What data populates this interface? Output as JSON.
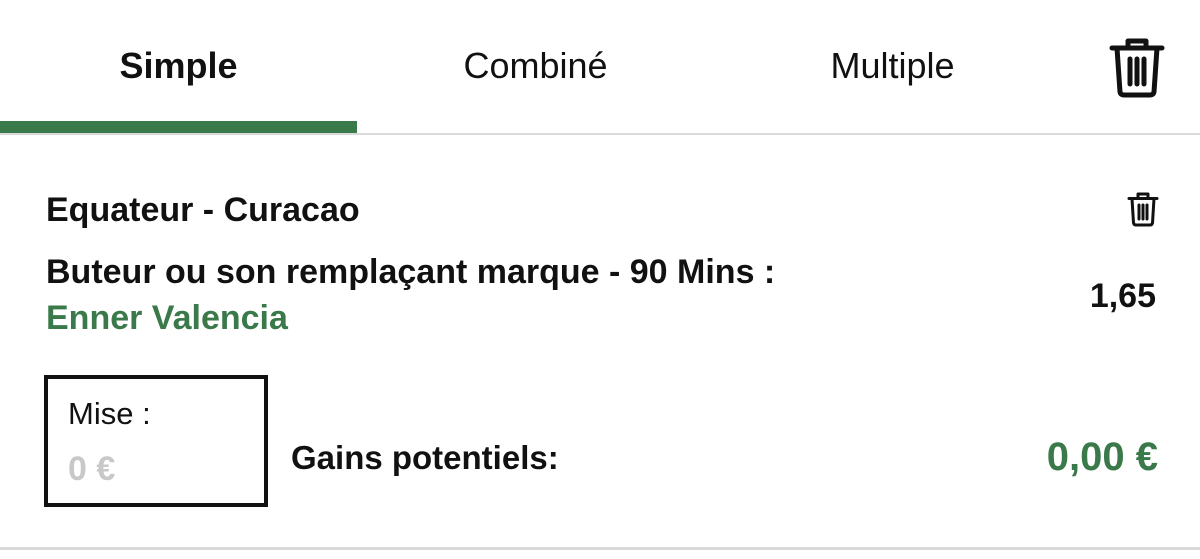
{
  "tabs": [
    {
      "label": "Simple",
      "active": true
    },
    {
      "label": "Combiné",
      "active": false
    },
    {
      "label": "Multiple",
      "active": false
    }
  ],
  "icons": {
    "clear_all": "trash-icon",
    "remove_bet": "trash-icon"
  },
  "colors": {
    "accent": "#3a7a4a",
    "text": "#111111",
    "divider": "#d9d9d9",
    "placeholder": "#c8c8c8"
  },
  "bet": {
    "match": "Equateur - Curacao",
    "market": "Buteur ou son remplaçant marque - 90 Mins :",
    "selection": "Enner Valencia",
    "odds": "1,65",
    "stake": {
      "label": "Mise :",
      "value": "",
      "placeholder": "0 €"
    },
    "gains": {
      "label": "Gains potentiels:",
      "value": "0,00 €"
    }
  }
}
